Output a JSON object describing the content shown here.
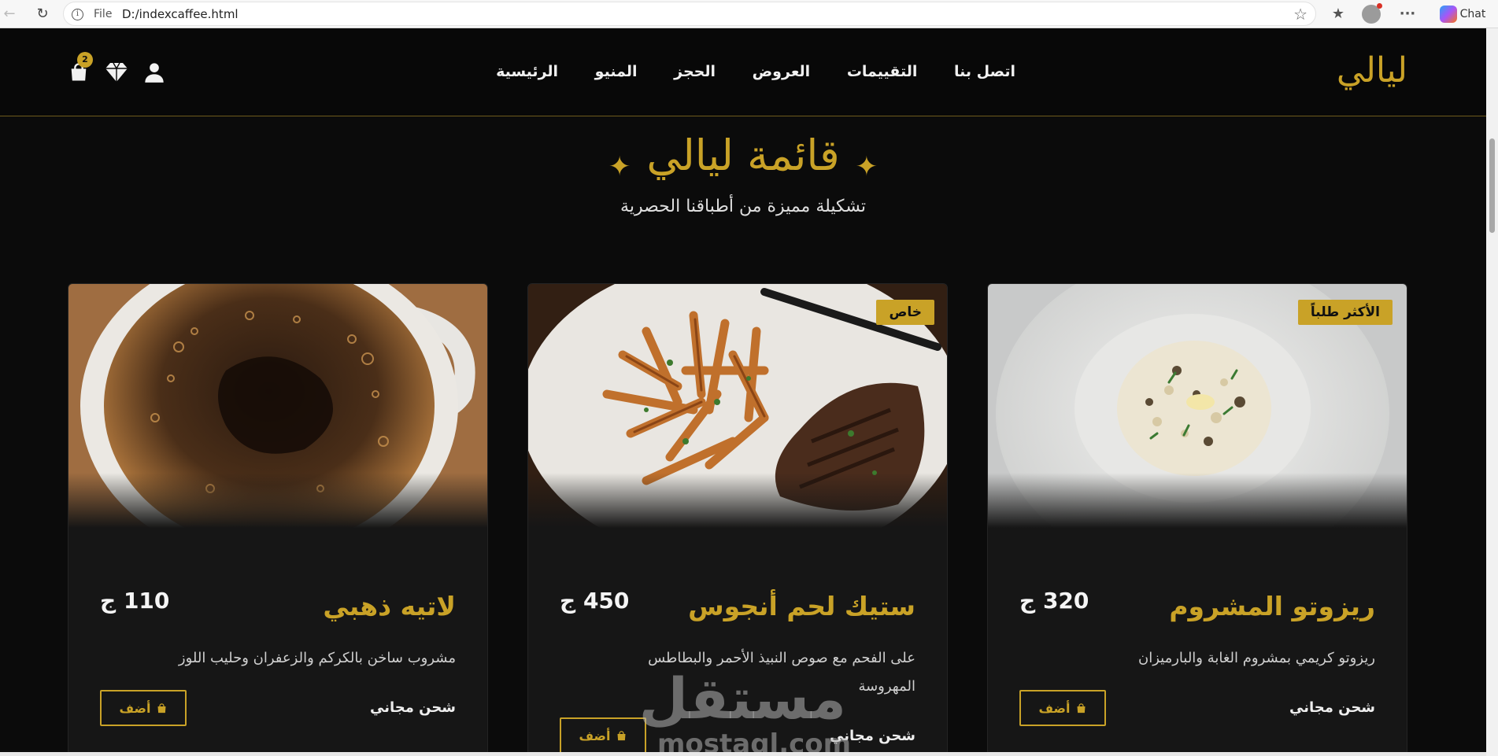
{
  "browser": {
    "file_label": "File",
    "url": "D:/indexcaffee.html",
    "chat_label": "Chat"
  },
  "header": {
    "logo": "ليالي",
    "nav": [
      "الرئيسية",
      "المنيو",
      "الحجز",
      "العروض",
      "التقييمات",
      "اتصل بنا"
    ],
    "cart_count": "2",
    "icons": [
      "cart-icon",
      "diamond-icon",
      "user-icon"
    ]
  },
  "menu": {
    "title": "قائمة ليالي",
    "subtitle": "تشكيلة مميزة من أطباقنا الحصرية"
  },
  "cards": [
    {
      "badge": "الأكثر طلباً",
      "name": "ريزوتو المشروم",
      "price": "320 ج",
      "description": "ريزوتو كريمي بمشروم الغابة والبارميزان",
      "shipping": "شحن مجاني",
      "add_label": "أضف"
    },
    {
      "badge": "خاص",
      "name": "ستيك لحم أنجوس",
      "price": "450 ج",
      "description": "على الفحم مع صوص النبيذ الأحمر والبطاطس المهروسة",
      "shipping": "شحن مجاني",
      "add_label": "أضف"
    },
    {
      "name": "لاتيه ذهبي",
      "price": "110 ج",
      "description": "مشروب ساخن بالكركم والزعفران وحليب اللوز",
      "shipping": "شحن مجاني",
      "add_label": "أضف"
    }
  ],
  "watermark": {
    "arabic": "مستقل",
    "latin": "mostaql.com"
  },
  "colors": {
    "accent_gold": "#c9a227",
    "background": "#0b0b0b",
    "card_background": "#161616"
  }
}
